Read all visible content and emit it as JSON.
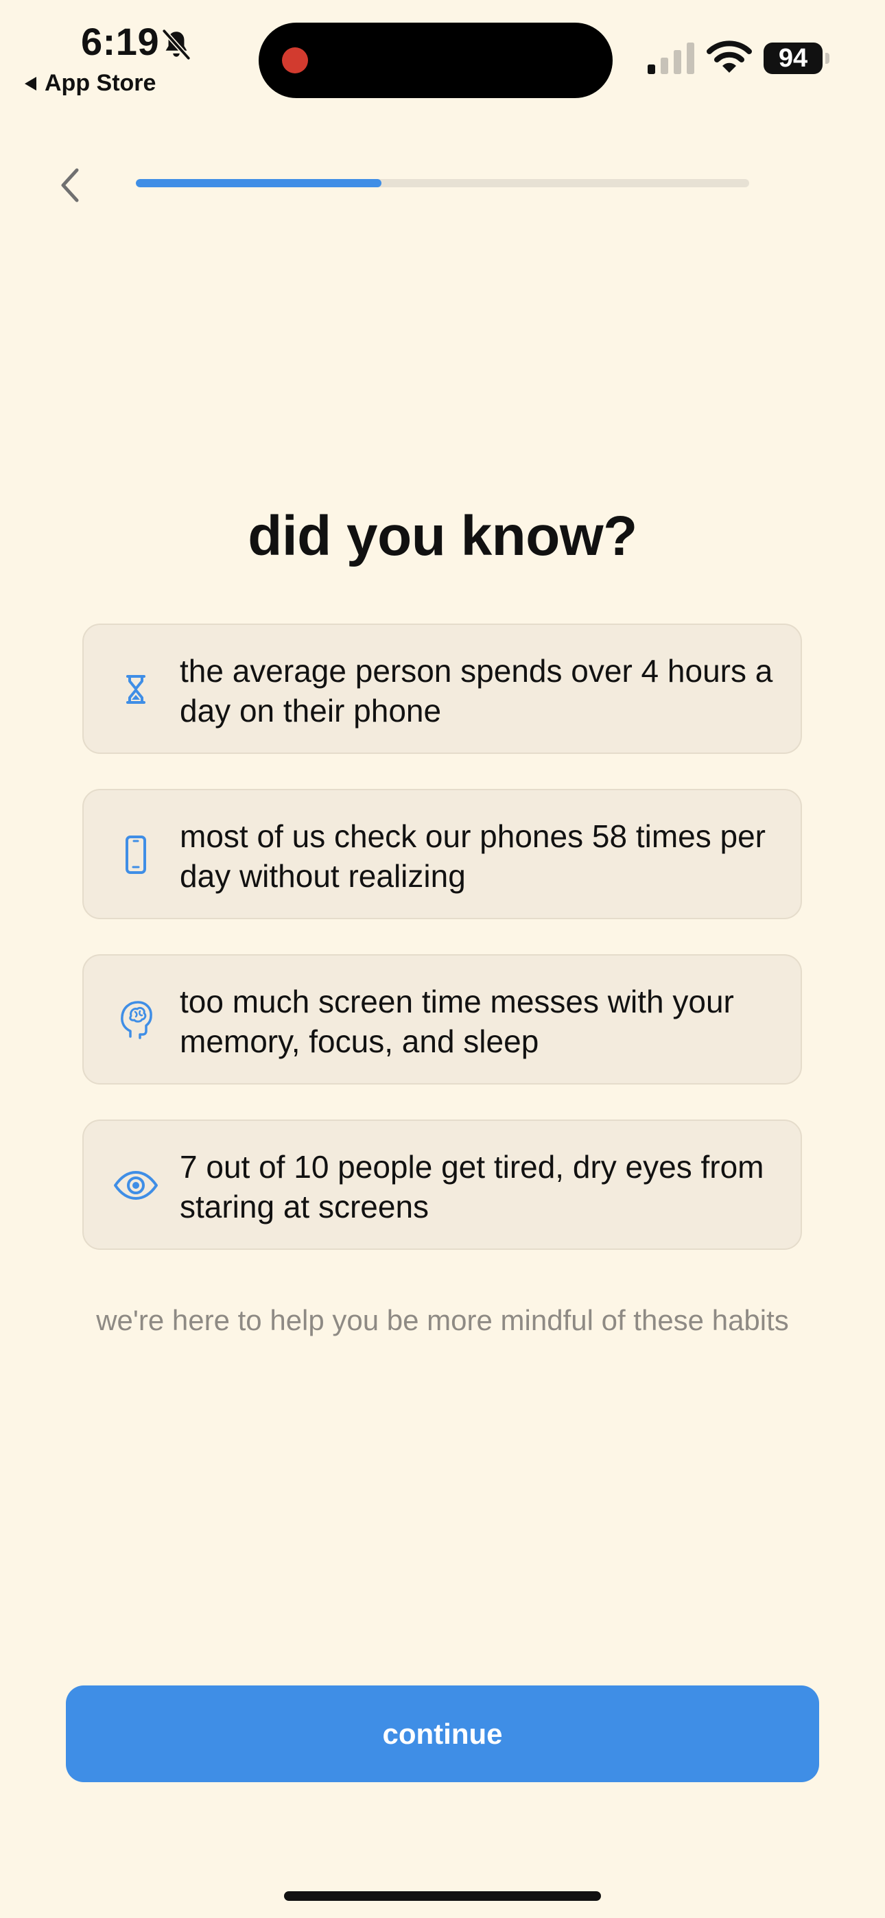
{
  "status_bar": {
    "time": "6:19",
    "back_label": "App Store",
    "battery": "94"
  },
  "header": {
    "progress_fraction": 0.4
  },
  "main": {
    "title": "did you know?",
    "facts": [
      {
        "icon": "hourglass-icon",
        "text": "the average person spends over 4 hours a day on their phone"
      },
      {
        "icon": "phone-icon",
        "text": "most of us check our phones 58 times per day without realizing"
      },
      {
        "icon": "brain-head-icon",
        "text": "too much screen time messes with your memory, focus, and sleep"
      },
      {
        "icon": "eye-icon",
        "text": "7 out of 10 people get tired, dry eyes from staring at screens"
      }
    ],
    "subtitle": "we're here to help you be more mindful of these habits"
  },
  "footer": {
    "continue_label": "continue"
  },
  "colors": {
    "background": "#fdf6e6",
    "accent": "#3f8ee6",
    "card": "#f3ebdd",
    "muted_text": "#8e8a84"
  }
}
